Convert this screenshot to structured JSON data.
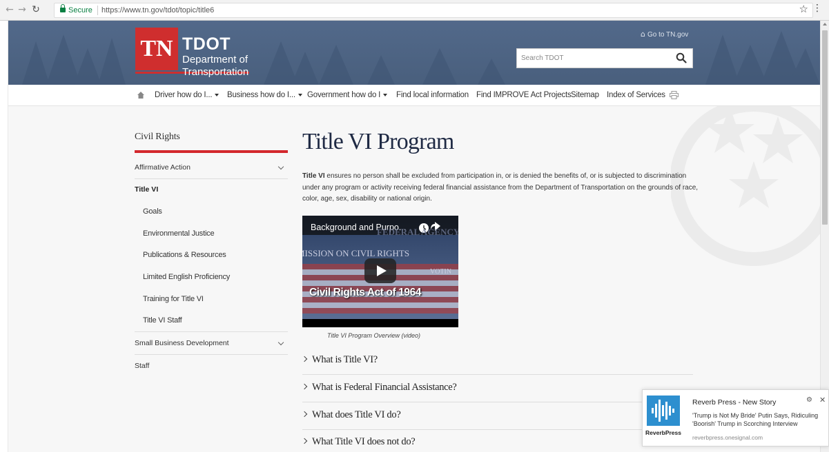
{
  "browser": {
    "secure_label": "Secure",
    "url": "https://www.tn.gov/tdot/topic/title6"
  },
  "header": {
    "logo_abbr": "TN",
    "logo_title": "TDOT",
    "logo_sub1": "Department of",
    "logo_sub2": "Transportation",
    "goto_label": "Go to TN.gov",
    "search_placeholder": "Search TDOT"
  },
  "topnav": {
    "items": [
      "Driver how do I...",
      "Business how do I...",
      "Government how do I",
      "Find local information",
      "Find IMPROVE Act Projects",
      "Sitemap",
      "Index of Services"
    ]
  },
  "sidebar": {
    "title": "Civil Rights",
    "items": [
      "Affirmative Action",
      "Title VI",
      "Goals",
      "Environmental Justice",
      "Publications & Resources",
      "Limited English Proficiency",
      "Training for Title VI",
      "Title VI Staff",
      "Small Business Development",
      "Staff"
    ]
  },
  "main": {
    "title": "Title VI Program",
    "intro_bold": "Title VI",
    "intro_rest": " ensures no person shall be excluded from participation in, or is denied the benefits of, or is subjected to discrimination under any program or activity receiving federal financial assistance from the Department of Transportation on the grounds of race, color, age, sex, disability or national origin.",
    "video": {
      "title": "Background and Purpo...",
      "line1": "FEDERAL AGENCY AS",
      "line2": "MISSION ON CIVIL RIGHTS",
      "line3": "VOTIN",
      "headline": "Civil Rights Act of 1964",
      "caption": "Title VI Program Overview (video)"
    },
    "accordion": [
      "What is Title VI?",
      "What is Federal Financial Assistance?",
      "What does Title VI do?",
      "What Title VI does not do?"
    ]
  },
  "notification": {
    "title": "Reverb Press - New Story",
    "body": "'Trump is Not My Bride' Putin Says, Ridiculing 'Boorish' Trump in Scorching Interview",
    "domain": "reverbpress.onesignal.com",
    "logo_label": "ReverbPress"
  },
  "colors": {
    "header_bg": "#4b6383",
    "logo_red": "#cf2e2e",
    "title_navy": "#1f2a44",
    "accent_red": "#d3272d"
  }
}
